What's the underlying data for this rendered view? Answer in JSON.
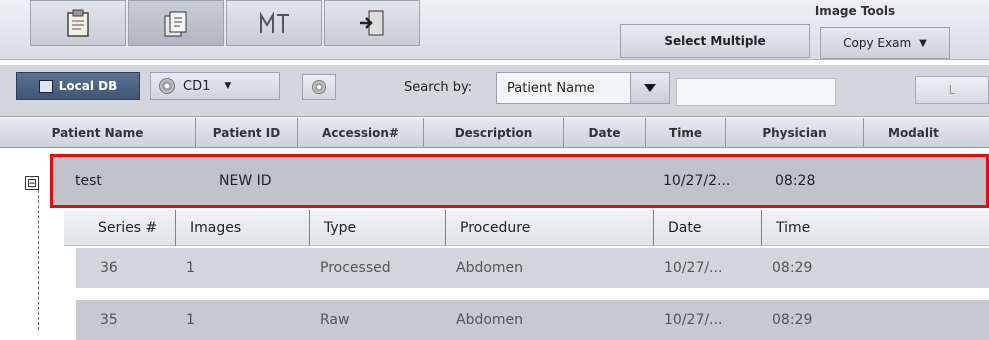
{
  "toolbar": {
    "tools": [
      {
        "icon": "clipboard-icon"
      },
      {
        "icon": "documents-icon"
      },
      {
        "icon": "patient-id-icon"
      },
      {
        "icon": "export-door-icon"
      }
    ],
    "image_tools_label": "Image Tools",
    "select_multiple_label": "Select Multiple",
    "copy_exam_label": "Copy Exam"
  },
  "source_bar": {
    "local_db_label": "Local DB",
    "cd_label": "CD1",
    "search_by_label": "Search by:",
    "search_field_value": "Patient Name",
    "search_input_value": "",
    "right_button_label": "L"
  },
  "columns": [
    "Patient Name",
    "Patient ID",
    "Accession#",
    "Description",
    "Date",
    "Time",
    "Physician",
    "Modalit"
  ],
  "patient": {
    "expander": "⊟",
    "name": "test",
    "id": "NEW ID",
    "date": "10/27/2...",
    "time": "08:28"
  },
  "series_columns": [
    "Series #",
    "Images",
    "Type",
    "Procedure",
    "Date",
    "Time"
  ],
  "series": [
    {
      "series_num": "36",
      "images": "1",
      "type": "Processed",
      "procedure": "Abdomen",
      "date": "10/27/...",
      "time": "08:29"
    },
    {
      "series_num": "35",
      "images": "1",
      "type": "Raw",
      "procedure": "Abdomen",
      "date": "10/27/...",
      "time": "08:29"
    }
  ],
  "colors": {
    "selection_outline": "#e01010",
    "local_db_bg": "#4a6282"
  }
}
